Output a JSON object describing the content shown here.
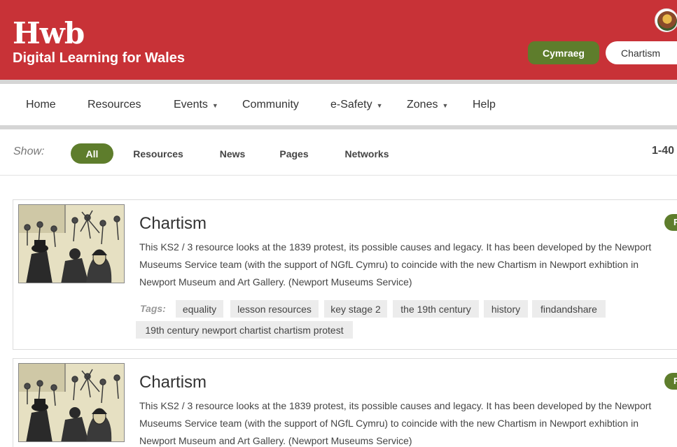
{
  "header": {
    "logo": "Hwb",
    "tagline": "Digital Learning for Wales",
    "language_button": "Cymraeg",
    "search_value": "Chartism",
    "brand_color": "#c83237",
    "accent_color": "#5e7d2c"
  },
  "nav": {
    "items": [
      {
        "label": "Home"
      },
      {
        "label": "Resources"
      },
      {
        "label": "Events",
        "dropdown": "▼"
      },
      {
        "label": "Community"
      },
      {
        "label": "e-Safety",
        "dropdown": "▼"
      },
      {
        "label": "Zones",
        "dropdown": "▼"
      },
      {
        "label": "Help"
      }
    ]
  },
  "filters": {
    "label": "Show:",
    "options": [
      "All",
      "Resources",
      "News",
      "Pages",
      "Networks"
    ],
    "selected": "All",
    "count": "1-40"
  },
  "results": [
    {
      "title": "Chartism",
      "description_lines": [
        "This KS2 / 3 resource looks at the 1839 protest, its possible causes and legacy. It has been developed by the Newport",
        "Museums Service team (with the support of NGfL Cymru) to coincide with the new Chartism in Newport exhibtion in",
        "Newport Museum and Art Gallery. (Newport Museums Service)"
      ],
      "tags_label": "Tags:",
      "tags": [
        "equality",
        "lesson resources",
        "key stage 2",
        "the 19th century",
        "history",
        "findandshare",
        "19th century newport chartist chartism protest"
      ],
      "thumbnail_icon": "chartist-protest-illustration",
      "badge": "R"
    },
    {
      "title": "Chartism",
      "description_lines": [
        "This KS2 / 3 resource looks at the 1839 protest, its possible causes and legacy. It has been developed by the Newport",
        "Museums Service team (with the support of NGfL Cymru) to coincide with the new Chartism in Newport exhibtion in",
        "Newport Museum and Art Gallery. (Newport Museums Service)"
      ],
      "thumbnail_icon": "chartist-protest-illustration",
      "badge": "R"
    }
  ]
}
